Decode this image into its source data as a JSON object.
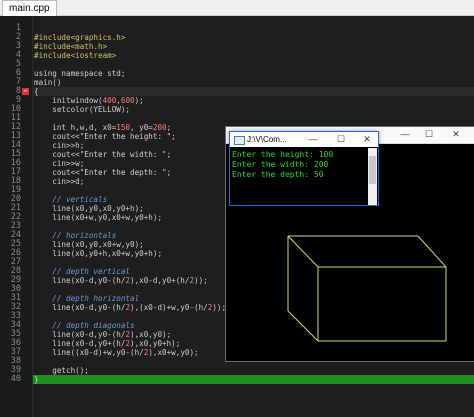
{
  "tab": {
    "label": "main.cpp"
  },
  "editor": {
    "line_numbers": [
      "1",
      "2",
      "3",
      "4",
      "5",
      "6",
      "7",
      "8",
      "9",
      "10",
      "11",
      "12",
      "13",
      "14",
      "15",
      "16",
      "17",
      "18",
      "19",
      "20",
      "21",
      "22",
      "23",
      "24",
      "25",
      "26",
      "27",
      "28",
      "29",
      "30",
      "31",
      "32",
      "33",
      "34",
      "35",
      "36",
      "37",
      "38",
      "39",
      "40"
    ],
    "fold_marker": "−",
    "lines": [
      "",
      "#include<graphics.h>",
      "#include<math.h>",
      "#include<iostream>",
      "",
      "using namespace std;",
      "main()",
      "{",
      "    initwindow(400,600);",
      "    setcolor(YELLOW);",
      "",
      "    int h,w,d, x0=150, y0=200;",
      "    cout<<\"Enter the height: \";",
      "    cin>>h;",
      "    cout<<\"Enter the width: \";",
      "    cin>>w;",
      "    cout<<\"Enter the depth: \";",
      "    cin>>d;",
      "",
      "    // verticals",
      "    line(x0,y0,x0,y0+h);",
      "    line(x0+w,y0,x0+w,y0+h);",
      "",
      "    // horizontals",
      "    line(x0,y0,x0+w,y0);",
      "    line(x0,y0+h,x0+w,y0+h);",
      "",
      "    // depth vertical",
      "    line(x0-d,y0-(h/2),x0-d,y0+(h/2));",
      "",
      "    // depth horizontal",
      "    line(x0-d,y0-(h/2),(x0-d)+w,y0-(h/2));",
      "",
      "    // depth diagonals",
      "    line(x0-d,y0-(h/2),x0,y0);",
      "    line(x0-d,y0+(h/2),x0,y0+h);",
      "    line((x0-d)+w,y0-(h/2),x0+w,y0);",
      "",
      "    getch();",
      "}"
    ]
  },
  "console_window": {
    "title": ""
  },
  "popup_window": {
    "title": "J:\\V\\Com...",
    "minimize": "—",
    "maximize": "☐",
    "close": "✕",
    "output": [
      "Enter the height: 100",
      "Enter the width: 200",
      "Enter the depth: 50"
    ]
  },
  "graphics_window": {
    "min": "—",
    "max": "☐",
    "close": "✕"
  },
  "colors": {
    "box": "#d8d86a",
    "console_text": "#2fd82f",
    "highlight": "#1f8f1f"
  }
}
